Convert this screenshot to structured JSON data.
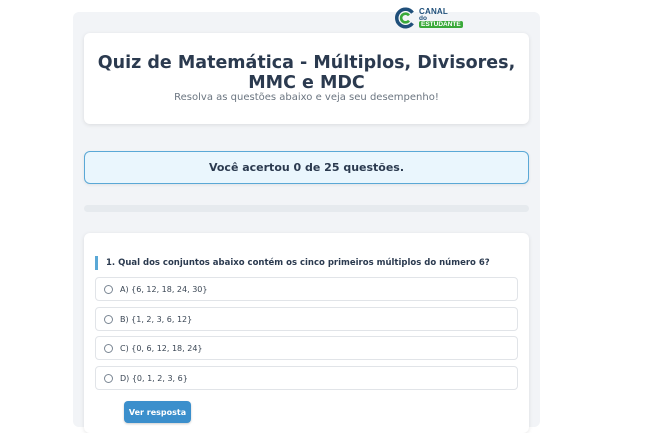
{
  "brand": {
    "name_line1": "CANAL",
    "name_line2_prefix": "do ",
    "name_line2_highlight": "ESTUDANTE",
    "colors": {
      "blue": "#1f4f7a",
      "green": "#3aa93a"
    }
  },
  "header": {
    "title": "Quiz de Matemática - Múltiplos, Divisores, MMC e MDC",
    "subtitle": "Resolva as questões abaixo e veja seu desempenho!"
  },
  "score": {
    "text": "Você acertou 0 de 25 questões.",
    "correct": 0,
    "total": 25
  },
  "progress": {
    "fraction": 0
  },
  "question": {
    "text": "1. Qual dos conjuntos abaixo contém os cinco primeiros múltiplos do número 6?",
    "options": [
      {
        "label": "A) {6, 12, 18, 24, 30}"
      },
      {
        "label": "B) {1, 2, 3, 6, 12}"
      },
      {
        "label": "C) {0, 6, 12, 18, 24}"
      },
      {
        "label": "D) {0, 1, 2, 3, 6}"
      }
    ],
    "answer_button": "Ver resposta"
  },
  "colors": {
    "accent": "#5aa8d6",
    "button": "#3b8fcc",
    "heading": "#2b3a4f"
  }
}
